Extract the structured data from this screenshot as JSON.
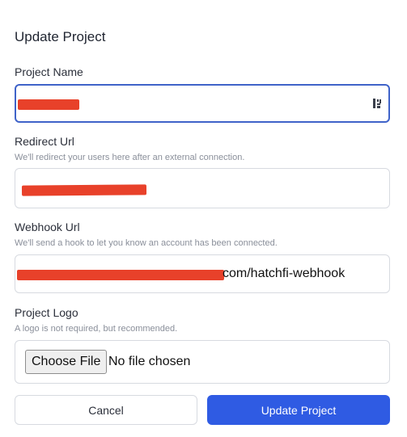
{
  "title": "Update Project",
  "project_name": {
    "label": "Project Name"
  },
  "redirect_url": {
    "label": "Redirect Url",
    "help": "We'll redirect your users here after an external connection."
  },
  "webhook_url": {
    "label": "Webhook Url",
    "help": "We'll send a hook to let you know an account has been connected.",
    "visible_value": "com/hatchfi-webhook"
  },
  "project_logo": {
    "label": "Project Logo",
    "help": "A logo is not required, but recommended.",
    "choose_label": "Choose File",
    "status": "No file chosen"
  },
  "buttons": {
    "cancel": "Cancel",
    "submit": "Update Project"
  },
  "colors": {
    "primary": "#2f5be3",
    "focus_border": "#3f63c9",
    "redaction": "#e8412a"
  },
  "icons": {
    "project_name_field": "password-manager-icon"
  }
}
